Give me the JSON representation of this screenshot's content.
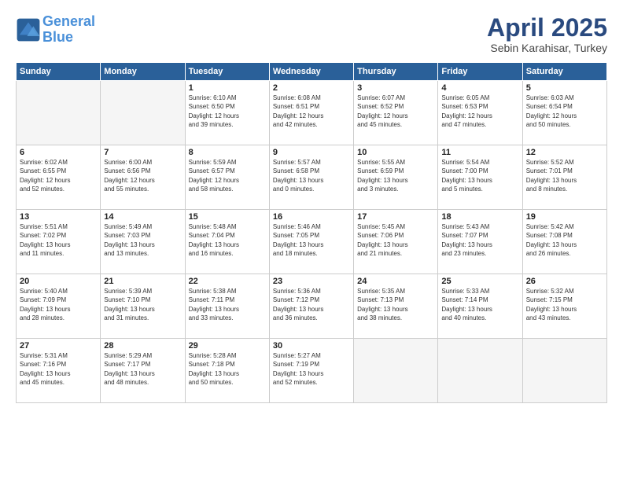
{
  "header": {
    "logo_line1": "General",
    "logo_line2": "Blue",
    "month": "April 2025",
    "location": "Sebin Karahisar, Turkey"
  },
  "weekdays": [
    "Sunday",
    "Monday",
    "Tuesday",
    "Wednesday",
    "Thursday",
    "Friday",
    "Saturday"
  ],
  "weeks": [
    [
      {
        "day": "",
        "info": ""
      },
      {
        "day": "",
        "info": ""
      },
      {
        "day": "1",
        "info": "Sunrise: 6:10 AM\nSunset: 6:50 PM\nDaylight: 12 hours\nand 39 minutes."
      },
      {
        "day": "2",
        "info": "Sunrise: 6:08 AM\nSunset: 6:51 PM\nDaylight: 12 hours\nand 42 minutes."
      },
      {
        "day": "3",
        "info": "Sunrise: 6:07 AM\nSunset: 6:52 PM\nDaylight: 12 hours\nand 45 minutes."
      },
      {
        "day": "4",
        "info": "Sunrise: 6:05 AM\nSunset: 6:53 PM\nDaylight: 12 hours\nand 47 minutes."
      },
      {
        "day": "5",
        "info": "Sunrise: 6:03 AM\nSunset: 6:54 PM\nDaylight: 12 hours\nand 50 minutes."
      }
    ],
    [
      {
        "day": "6",
        "info": "Sunrise: 6:02 AM\nSunset: 6:55 PM\nDaylight: 12 hours\nand 52 minutes."
      },
      {
        "day": "7",
        "info": "Sunrise: 6:00 AM\nSunset: 6:56 PM\nDaylight: 12 hours\nand 55 minutes."
      },
      {
        "day": "8",
        "info": "Sunrise: 5:59 AM\nSunset: 6:57 PM\nDaylight: 12 hours\nand 58 minutes."
      },
      {
        "day": "9",
        "info": "Sunrise: 5:57 AM\nSunset: 6:58 PM\nDaylight: 13 hours\nand 0 minutes."
      },
      {
        "day": "10",
        "info": "Sunrise: 5:55 AM\nSunset: 6:59 PM\nDaylight: 13 hours\nand 3 minutes."
      },
      {
        "day": "11",
        "info": "Sunrise: 5:54 AM\nSunset: 7:00 PM\nDaylight: 13 hours\nand 5 minutes."
      },
      {
        "day": "12",
        "info": "Sunrise: 5:52 AM\nSunset: 7:01 PM\nDaylight: 13 hours\nand 8 minutes."
      }
    ],
    [
      {
        "day": "13",
        "info": "Sunrise: 5:51 AM\nSunset: 7:02 PM\nDaylight: 13 hours\nand 11 minutes."
      },
      {
        "day": "14",
        "info": "Sunrise: 5:49 AM\nSunset: 7:03 PM\nDaylight: 13 hours\nand 13 minutes."
      },
      {
        "day": "15",
        "info": "Sunrise: 5:48 AM\nSunset: 7:04 PM\nDaylight: 13 hours\nand 16 minutes."
      },
      {
        "day": "16",
        "info": "Sunrise: 5:46 AM\nSunset: 7:05 PM\nDaylight: 13 hours\nand 18 minutes."
      },
      {
        "day": "17",
        "info": "Sunrise: 5:45 AM\nSunset: 7:06 PM\nDaylight: 13 hours\nand 21 minutes."
      },
      {
        "day": "18",
        "info": "Sunrise: 5:43 AM\nSunset: 7:07 PM\nDaylight: 13 hours\nand 23 minutes."
      },
      {
        "day": "19",
        "info": "Sunrise: 5:42 AM\nSunset: 7:08 PM\nDaylight: 13 hours\nand 26 minutes."
      }
    ],
    [
      {
        "day": "20",
        "info": "Sunrise: 5:40 AM\nSunset: 7:09 PM\nDaylight: 13 hours\nand 28 minutes."
      },
      {
        "day": "21",
        "info": "Sunrise: 5:39 AM\nSunset: 7:10 PM\nDaylight: 13 hours\nand 31 minutes."
      },
      {
        "day": "22",
        "info": "Sunrise: 5:38 AM\nSunset: 7:11 PM\nDaylight: 13 hours\nand 33 minutes."
      },
      {
        "day": "23",
        "info": "Sunrise: 5:36 AM\nSunset: 7:12 PM\nDaylight: 13 hours\nand 36 minutes."
      },
      {
        "day": "24",
        "info": "Sunrise: 5:35 AM\nSunset: 7:13 PM\nDaylight: 13 hours\nand 38 minutes."
      },
      {
        "day": "25",
        "info": "Sunrise: 5:33 AM\nSunset: 7:14 PM\nDaylight: 13 hours\nand 40 minutes."
      },
      {
        "day": "26",
        "info": "Sunrise: 5:32 AM\nSunset: 7:15 PM\nDaylight: 13 hours\nand 43 minutes."
      }
    ],
    [
      {
        "day": "27",
        "info": "Sunrise: 5:31 AM\nSunset: 7:16 PM\nDaylight: 13 hours\nand 45 minutes."
      },
      {
        "day": "28",
        "info": "Sunrise: 5:29 AM\nSunset: 7:17 PM\nDaylight: 13 hours\nand 48 minutes."
      },
      {
        "day": "29",
        "info": "Sunrise: 5:28 AM\nSunset: 7:18 PM\nDaylight: 13 hours\nand 50 minutes."
      },
      {
        "day": "30",
        "info": "Sunrise: 5:27 AM\nSunset: 7:19 PM\nDaylight: 13 hours\nand 52 minutes."
      },
      {
        "day": "",
        "info": ""
      },
      {
        "day": "",
        "info": ""
      },
      {
        "day": "",
        "info": ""
      }
    ]
  ]
}
